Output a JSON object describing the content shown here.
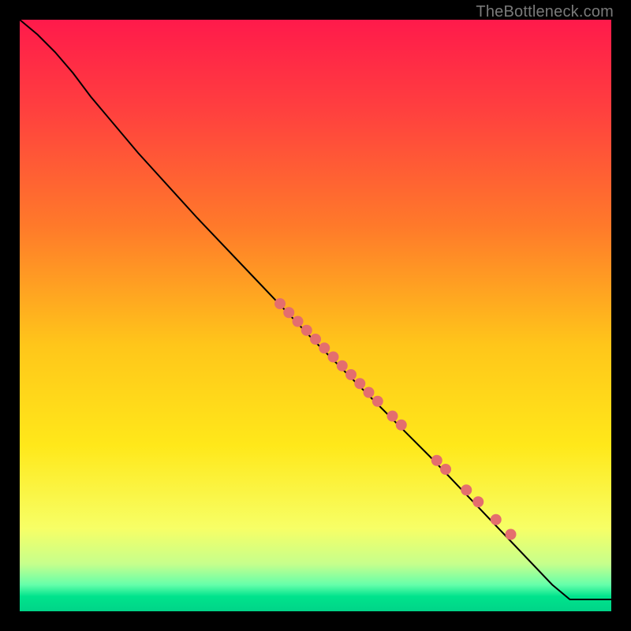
{
  "watermark": "TheBottleneck.com",
  "chart_data": {
    "type": "line",
    "title": "",
    "xlabel": "",
    "ylabel": "",
    "xlim": [
      0,
      100
    ],
    "ylim": [
      0,
      100
    ],
    "gradient_stops": [
      {
        "offset": 0.0,
        "color": "#ff1a4b"
      },
      {
        "offset": 0.15,
        "color": "#ff3f3f"
      },
      {
        "offset": 0.35,
        "color": "#ff7a2a"
      },
      {
        "offset": 0.55,
        "color": "#ffc61a"
      },
      {
        "offset": 0.72,
        "color": "#ffe81a"
      },
      {
        "offset": 0.86,
        "color": "#f7ff66"
      },
      {
        "offset": 0.92,
        "color": "#c6ff8c"
      },
      {
        "offset": 0.955,
        "color": "#66ffaa"
      },
      {
        "offset": 0.975,
        "color": "#00e38c"
      },
      {
        "offset": 1.0,
        "color": "#00d488"
      }
    ],
    "curve": [
      {
        "x": 0.0,
        "y": 100.0
      },
      {
        "x": 3.0,
        "y": 97.5
      },
      {
        "x": 6.0,
        "y": 94.5
      },
      {
        "x": 9.0,
        "y": 91.0
      },
      {
        "x": 12.0,
        "y": 87.0
      },
      {
        "x": 20.0,
        "y": 77.5
      },
      {
        "x": 30.0,
        "y": 66.5
      },
      {
        "x": 40.0,
        "y": 56.0
      },
      {
        "x": 50.0,
        "y": 45.5
      },
      {
        "x": 60.0,
        "y": 35.5
      },
      {
        "x": 70.0,
        "y": 25.5
      },
      {
        "x": 80.0,
        "y": 15.0
      },
      {
        "x": 90.0,
        "y": 4.5
      },
      {
        "x": 93.0,
        "y": 2.0
      },
      {
        "x": 100.0,
        "y": 2.0
      }
    ],
    "markers": [
      {
        "x": 44.0,
        "y": 52.0
      },
      {
        "x": 45.5,
        "y": 50.5
      },
      {
        "x": 47.0,
        "y": 49.0
      },
      {
        "x": 48.5,
        "y": 47.5
      },
      {
        "x": 50.0,
        "y": 46.0
      },
      {
        "x": 51.5,
        "y": 44.5
      },
      {
        "x": 53.0,
        "y": 43.0
      },
      {
        "x": 54.5,
        "y": 41.5
      },
      {
        "x": 56.0,
        "y": 40.0
      },
      {
        "x": 57.5,
        "y": 38.5
      },
      {
        "x": 59.0,
        "y": 37.0
      },
      {
        "x": 60.5,
        "y": 35.5
      },
      {
        "x": 63.0,
        "y": 33.0
      },
      {
        "x": 64.5,
        "y": 31.5
      },
      {
        "x": 70.5,
        "y": 25.5
      },
      {
        "x": 72.0,
        "y": 24.0
      },
      {
        "x": 75.5,
        "y": 20.5
      },
      {
        "x": 77.5,
        "y": 18.5
      },
      {
        "x": 80.5,
        "y": 15.5
      },
      {
        "x": 83.0,
        "y": 13.0
      }
    ],
    "marker_color": "#e46e6e",
    "marker_radius": 7,
    "line_color": "#000000"
  }
}
